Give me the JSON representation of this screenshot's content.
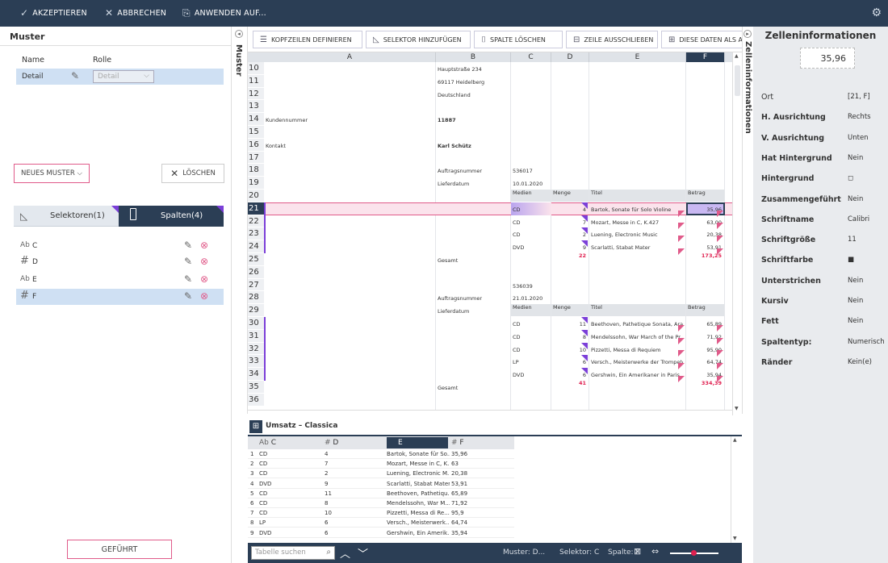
{
  "topbar": {
    "accept": "AKZEPTIEREN",
    "cancel": "ABBRECHEN",
    "apply": "ANWENDEN AUF..."
  },
  "left": {
    "title": "Muster",
    "col_name": "Name",
    "col_role": "Rolle",
    "pattern_name": "Detail",
    "pattern_role": "Detail",
    "new_pattern": "NEUES MUSTER",
    "delete": "LÖSCHEN",
    "tab_selectors": "Selektoren(1)",
    "tab_columns": "Spalten(4)",
    "columns": [
      {
        "type": "Ab",
        "name": "C"
      },
      {
        "type": "#",
        "name": "D"
      },
      {
        "type": "Ab",
        "name": "E"
      },
      {
        "type": "#",
        "name": "F"
      }
    ],
    "guided": "GEFÜHRT"
  },
  "side_labels": {
    "muster": "Muster",
    "zell": "Zelleninformationen"
  },
  "toolbar": {
    "define_headers": "KOPFZEILEN DEFINIEREN",
    "add_selector": "SELEKTOR HINZUFÜGEN",
    "delete_column": "SPALTE LÖSCHEN",
    "exclude_row": "ZEILE AUSSCHLIEßEN",
    "these_data": "DIESE DATEN ALS ANH"
  },
  "grid": {
    "columns": [
      "A",
      "B",
      "C",
      "D",
      "E",
      "F"
    ],
    "rows": [
      "10",
      "11",
      "12",
      "13",
      "14",
      "15",
      "16",
      "17",
      "18",
      "19",
      "20",
      "21",
      "22",
      "23",
      "24",
      "25",
      "26",
      "27",
      "28",
      "29",
      "30",
      "31",
      "32",
      "33",
      "34",
      "35",
      "36"
    ],
    "cells": {
      "b10": "Hauptstraße 234",
      "b11": "69117 Heidelberg",
      "b12": "Deutschland",
      "a14": "Kundennummer",
      "b14": "11887",
      "a16": "Kontakt",
      "b16": "Karl Schütz",
      "b18": "Auftragsnummer",
      "c18": "536017",
      "b19": "Lieferdatum",
      "c19": "10.01.2020",
      "h20c": "Medien",
      "h20d": "Menge",
      "h20e": "Titel",
      "h20f": "Betrag",
      "c21": "CD",
      "d21": "4",
      "e21": "Bartok, Sonate für Solo Violine",
      "f21": "35,96",
      "c22": "CD",
      "d22": "7",
      "e22": "Mozart, Messe in C, K.427",
      "f22": "63,00",
      "c23": "CD",
      "d23": "2",
      "e23": "Luening, Electronic Music",
      "f23": "20,38",
      "c24": "DVD",
      "d24": "9",
      "e24": "Scarlatti, Stabat Mater",
      "f24": "53,91",
      "b25": "Gesamt",
      "d25": "22",
      "f25": "173,25",
      "c27": "536039",
      "b28": "Auftragsnummer",
      "c28": "21.01.2020",
      "b29": "Lieferdatum",
      "h29c": "Medien",
      "h29d": "Menge",
      "h29e": "Titel",
      "h29f": "Betrag",
      "c30": "CD",
      "d30": "11",
      "e30": "Beethoven, Pathetique Sonata, Arau",
      "f30": "65,89",
      "c31": "CD",
      "d31": "8",
      "e31": "Mendelssohn, War March of the Pr...",
      "f31": "71,92",
      "c32": "CD",
      "d32": "10",
      "e32": "Pizzetti, Messa di Requiem",
      "f32": "95,90",
      "c33": "LP",
      "d33": "6",
      "e33": "Versch., Meisterwerke der Trompete",
      "f33": "64,74",
      "c34": "DVD",
      "d34": "6",
      "e34": "Gershwin, Ein Amerikaner in Paris",
      "f34": "35,94",
      "b35": "Gesamt",
      "d35": "41",
      "f35": "334,39"
    }
  },
  "right": {
    "title": "Zelleninformationen",
    "value": "35,96",
    "props": [
      {
        "k": "Ort",
        "v": "[21, F]"
      },
      {
        "k": "H. Ausrichtung",
        "v": "Rechts"
      },
      {
        "k": "V. Ausrichtung",
        "v": "Unten"
      },
      {
        "k": "Hat Hintergrund",
        "v": "Nein"
      },
      {
        "k": "Hintergrund",
        "v": "◻"
      },
      {
        "k": "Zusammengeführt",
        "v": "Nein"
      },
      {
        "k": "Schriftname",
        "v": "Calibri"
      },
      {
        "k": "Schriftgröße",
        "v": "11"
      },
      {
        "k": "Schriftfarbe",
        "v": "■"
      },
      {
        "k": "Unterstrichen",
        "v": "Nein"
      },
      {
        "k": "Kursiv",
        "v": "Nein"
      },
      {
        "k": "Fett",
        "v": "Nein"
      },
      {
        "k": "Spaltentyp:",
        "v": "Numerisch"
      },
      {
        "k": "Ränder",
        "v": "Kein(e)"
      }
    ]
  },
  "sheet_tab": "Umsatz – Classica",
  "preview": {
    "headers": [
      {
        "type": "Ab",
        "name": "C"
      },
      {
        "type": "#",
        "name": "D"
      },
      {
        "type": "",
        "name": "E"
      },
      {
        "type": "#",
        "name": "F"
      }
    ],
    "rows": [
      [
        "1",
        "CD",
        "4",
        "Bartok, Sonate für So...",
        "35,96"
      ],
      [
        "2",
        "CD",
        "7",
        "Mozart, Messe in C, K...",
        "63"
      ],
      [
        "3",
        "CD",
        "2",
        "Luening, Electronic M...",
        "20,38"
      ],
      [
        "4",
        "DVD",
        "9",
        "Scarlatti, Stabat Mater",
        "53,91"
      ],
      [
        "5",
        "CD",
        "11",
        "Beethoven, Pathetiqu...",
        "65,89"
      ],
      [
        "6",
        "CD",
        "8",
        "Mendelssohn, War M...",
        "71,92"
      ],
      [
        "7",
        "CD",
        "10",
        "Pizzetti, Messa di Re...",
        "95,9"
      ],
      [
        "8",
        "LP",
        "6",
        "Versch., Meisterwerk...",
        "64,74"
      ],
      [
        "9",
        "DVD",
        "6",
        "Gershwin, Ein Amerik...",
        "35,94"
      ]
    ]
  },
  "status": {
    "search_placeholder": "Tabelle suchen",
    "muster": "Muster: D...",
    "selector": "Selektor: C",
    "column": "Spalte: F"
  },
  "colors": {
    "accent": "#2b3e55",
    "pink": "#e05b8a",
    "purple": "#7b3fd8",
    "selection": "#cfe0f3"
  }
}
